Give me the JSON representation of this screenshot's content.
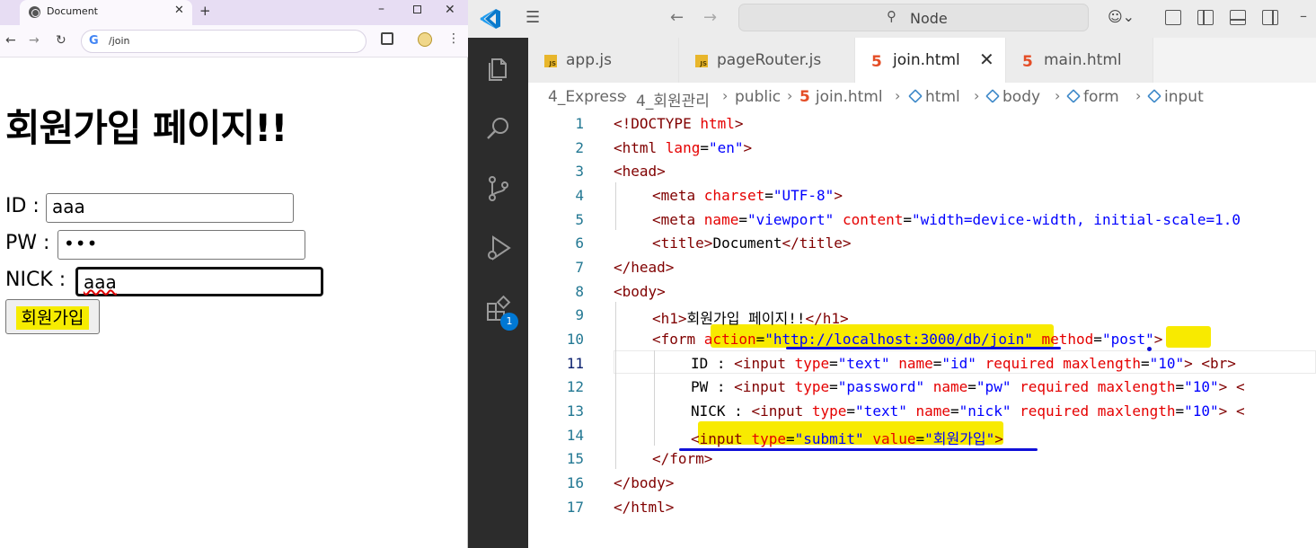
{
  "browser": {
    "tab_title": "Document",
    "tab_close": "✕",
    "new_tab": "+",
    "window_controls": {
      "minimize": "–",
      "close": "✕"
    },
    "url": "/join",
    "icons": [
      "globe-icon",
      "back-arrow-icon",
      "forward-arrow-icon",
      "reload-icon",
      "google-icon",
      "extensions-icon",
      "profile-icon",
      "more-menu-icon"
    ]
  },
  "page": {
    "heading": "회원가입 페이지!!",
    "fields": [
      {
        "label": "ID :",
        "value": "aaa"
      },
      {
        "label": "PW :",
        "value": "•••"
      },
      {
        "label": "NICK :",
        "value": "aaa"
      }
    ],
    "submit_label": "회원가입"
  },
  "editor": {
    "search_text": "Node",
    "tabs": [
      {
        "label": "app.js",
        "kind": "js"
      },
      {
        "label": "pageRouter.js",
        "kind": "js"
      },
      {
        "label": "join.html",
        "kind": "html",
        "active": true
      },
      {
        "label": "main.html",
        "kind": "html"
      }
    ],
    "tab_close": "✕",
    "breadcrumbs": [
      "4_Express",
      "4_회원관리",
      "public",
      "join.html",
      "html",
      "body",
      "form",
      "input"
    ],
    "extensions_badge": "1",
    "line_numbers": [
      "1",
      "2",
      "3",
      "4",
      "5",
      "6",
      "7",
      "8",
      "9",
      "10",
      "11",
      "12",
      "13",
      "14",
      "15",
      "16",
      "17"
    ],
    "active_line": 11,
    "code": {
      "l1a": "<!DOCTYPE ",
      "l1b": "html",
      "l1c": ">",
      "l2a": "<html ",
      "l2b": "lang",
      "l2c": "=",
      "l2d": "\"en\"",
      "l2e": ">",
      "l3a": "<head>",
      "l4a": "<meta ",
      "l4b": "charset",
      "l4c": "=",
      "l4d": "\"UTF-8\"",
      "l4e": ">",
      "l5a": "<meta ",
      "l5b": "name",
      "l5c": "=",
      "l5d": "\"viewport\"",
      "l5e": " ",
      "l5f": "content",
      "l5g": "=",
      "l5h": "\"width=device-width, initial-scale=1.0",
      "l6a": "<title>",
      "l6b": "Document",
      "l6c": "</title>",
      "l7a": "</head>",
      "l8a": "<body>",
      "l9a": "<h1>",
      "l9b": "회원가입 페이지!!",
      "l9c": "</h1>",
      "l10a": "<form ",
      "l10b": "action",
      "l10c": "=",
      "l10d": "\"http://localhost:3000/db/join\"",
      "l10e": " ",
      "l10f": "method",
      "l10g": "=",
      "l10h": "\"post\"",
      "l10i": ">",
      "l11a": "ID : ",
      "l11b": "<input ",
      "l11c": "type",
      "l11d": "=",
      "l11e": "\"text\"",
      "l11f": " ",
      "l11g": "name",
      "l11h": "=",
      "l11i": "\"id\"",
      "l11j": " ",
      "l11k": "required",
      "l11l": " ",
      "l11m": "maxlength",
      "l11n": "=",
      "l11o": "\"10\"",
      "l11p": "> ",
      "l11q": "<br>",
      "l12a": "PW : ",
      "l12b": "<input ",
      "l12c": "type",
      "l12d": "=",
      "l12e": "\"password\"",
      "l12f": " ",
      "l12g": "name",
      "l12h": "=",
      "l12i": "\"pw\"",
      "l12j": " ",
      "l12k": "required",
      "l12l": " ",
      "l12m": "maxlength",
      "l12n": "=",
      "l12o": "\"10\"",
      "l12p": "> <",
      "l13a": "NICK : ",
      "l13b": "<input ",
      "l13c": "type",
      "l13d": "=",
      "l13e": "\"text\"",
      "l13f": " ",
      "l13g": "name",
      "l13h": "=",
      "l13i": "\"nick\"",
      "l13j": " ",
      "l13k": "required",
      "l13l": " ",
      "l13m": "maxlength",
      "l13n": "=",
      "l13o": "\"10\"",
      "l13p": "> <",
      "l14a": "<input ",
      "l14b": "type",
      "l14c": "=",
      "l14d": "\"submit\"",
      "l14e": " ",
      "l14f": "value",
      "l14g": "=",
      "l14h": "\"회원가입\"",
      "l14i": ">",
      "l15a": "</form>",
      "l16a": "</body>",
      "l17a": "</html>"
    }
  },
  "colors": {
    "highlight": "#f8ea00",
    "annotation_underline": "#1010d8",
    "activity_bar": "#2c2c2c",
    "html_tag": "#800000",
    "html_attr": "#e50000",
    "html_string": "#0000ff"
  }
}
